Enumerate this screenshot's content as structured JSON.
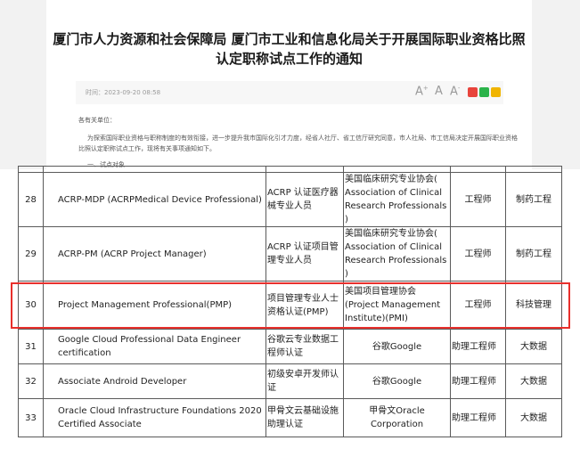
{
  "article": {
    "title_line1": "厦门市人力资源和社会保障局 厦门市工业和信息化局关于开展国际职业资格比照",
    "title_line2": "认定职称试点工作的通知",
    "time": "时间：2023-09-20 08:58",
    "font_large": "A",
    "font_medium": "A",
    "font_small": "A",
    "salutation": "各有关单位：",
    "para_line1": "为探索国际职业资格与职称制度的有效衔接，进一步提升我市国际化引才力度，经省人社厅、省工信厅研究同意，市人社局、市工信局决定开展国际职业资格",
    "para_line2": "比照认定职称试点工作，现将有关事项通知如下。",
    "section": "一、试点对象"
  },
  "share_icons": [
    "weibo-icon",
    "wechat-icon",
    "qzone-icon"
  ],
  "table": {
    "rows": [
      {
        "no": "28",
        "name": "ACRP-MDP (ACRPMedical Device Professional)",
        "cn": "ACRP 认证医疗器械专业人员",
        "org": "美国临床研究专业协会( Association of Clinical Research Professionals )",
        "level": "工程师",
        "field": "制药工程"
      },
      {
        "no": "29",
        "name": "ACRP-PM (ACRP Project Manager)",
        "cn": "ACRP 认证项目管理专业人员",
        "org": "美国临床研究专业协会( Association of Clinical Research Professionals )",
        "level": "工程师",
        "field": "制药工程"
      },
      {
        "no": "30",
        "name": "Project Management Professional(PMP)",
        "cn": "项目管理专业人士资格认证(PMP)",
        "org": "美国项目管理协会(Project Management Institute)(PMI)",
        "level": "工程师",
        "field": "科技管理"
      },
      {
        "no": "31",
        "name": "Google Cloud Professional Data Engineer certification",
        "cn": "谷歌云专业数据工程师认证",
        "org": "谷歌Google",
        "level": "助理工程师",
        "field": "大数据"
      },
      {
        "no": "32",
        "name": "Associate Android Developer",
        "cn": "初级安卓开发师认证",
        "org": "谷歌Google",
        "level": "助理工程师",
        "field": "大数据"
      },
      {
        "no": "33",
        "name": "Oracle Cloud Infrastructure Foundations 2020 Certified Associate",
        "cn": "甲骨文云基础设施助理认证",
        "org": "甲骨文Oracle Corporation",
        "level": "助理工程师",
        "field": "大数据"
      }
    ]
  },
  "highlight_color": "#e8302c"
}
